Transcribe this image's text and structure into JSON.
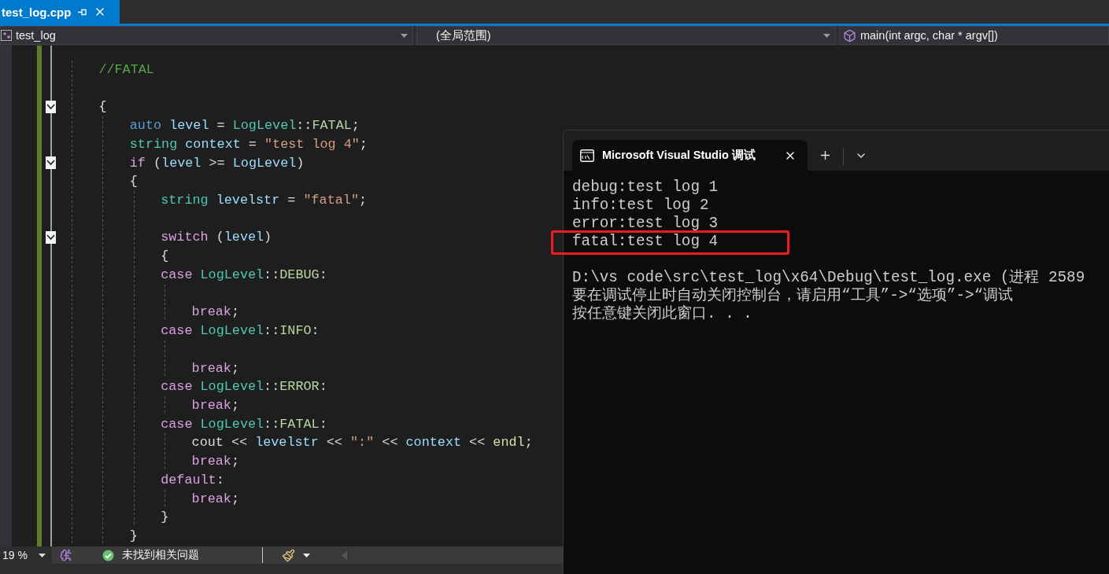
{
  "editor_tab": {
    "title": "test_log.cpp",
    "selected": true
  },
  "nav": {
    "project": "test_log",
    "scope": "(全局范围)",
    "member": "main(int argc, char * argv[])"
  },
  "code_lines": [
    {
      "kind": "code",
      "fold": false,
      "tokens": [
        {
          "kind": "comment",
          "text": "    //FATAL"
        }
      ]
    },
    {
      "kind": "blank",
      "fold": false
    },
    {
      "kind": "code",
      "fold": true,
      "tokens": [
        {
          "kind": "op",
          "text": "    {"
        }
      ]
    },
    {
      "kind": "code",
      "fold": false,
      "tokens": [
        {
          "kind": "type",
          "text": "        auto "
        },
        {
          "kind": "var",
          "text": "level"
        },
        {
          "kind": "op",
          "text": " = "
        },
        {
          "kind": "cls",
          "text": "LogLevel"
        },
        {
          "kind": "op",
          "text": "::"
        },
        {
          "kind": "member",
          "text": "FATAL"
        },
        {
          "kind": "op",
          "text": ";"
        }
      ]
    },
    {
      "kind": "code",
      "fold": false,
      "tokens": [
        {
          "kind": "cls",
          "text": "        string "
        },
        {
          "kind": "var",
          "text": "context"
        },
        {
          "kind": "op",
          "text": " = "
        },
        {
          "kind": "str",
          "text": "\"test log 4\""
        },
        {
          "kind": "op",
          "text": ";"
        }
      ]
    },
    {
      "kind": "code",
      "fold": true,
      "tokens": [
        {
          "kind": "kw",
          "text": "        if "
        },
        {
          "kind": "op",
          "text": "("
        },
        {
          "kind": "var",
          "text": "level"
        },
        {
          "kind": "op",
          "text": " >= "
        },
        {
          "kind": "var",
          "text": "LogLevel"
        },
        {
          "kind": "op",
          "text": ")"
        }
      ]
    },
    {
      "kind": "code",
      "fold": false,
      "tokens": [
        {
          "kind": "op",
          "text": "        {"
        }
      ]
    },
    {
      "kind": "code",
      "fold": false,
      "tokens": [
        {
          "kind": "cls",
          "text": "            string "
        },
        {
          "kind": "var",
          "text": "levelstr"
        },
        {
          "kind": "op",
          "text": " = "
        },
        {
          "kind": "str",
          "text": "\"fatal\""
        },
        {
          "kind": "op",
          "text": ";"
        }
      ]
    },
    {
      "kind": "blank",
      "fold": false
    },
    {
      "kind": "code",
      "fold": true,
      "tokens": [
        {
          "kind": "kw",
          "text": "            switch "
        },
        {
          "kind": "op",
          "text": "("
        },
        {
          "kind": "var",
          "text": "level"
        },
        {
          "kind": "op",
          "text": ")"
        }
      ]
    },
    {
      "kind": "code",
      "fold": false,
      "tokens": [
        {
          "kind": "op",
          "text": "            {"
        }
      ]
    },
    {
      "kind": "code",
      "fold": false,
      "tokens": [
        {
          "kind": "kw",
          "text": "            case "
        },
        {
          "kind": "cls",
          "text": "LogLevel"
        },
        {
          "kind": "op",
          "text": "::"
        },
        {
          "kind": "member",
          "text": "DEBUG"
        },
        {
          "kind": "op",
          "text": ":"
        }
      ]
    },
    {
      "kind": "blank",
      "fold": false
    },
    {
      "kind": "code",
      "fold": false,
      "tokens": [
        {
          "kind": "kw",
          "text": "                break"
        },
        {
          "kind": "op",
          "text": ";"
        }
      ]
    },
    {
      "kind": "code",
      "fold": false,
      "tokens": [
        {
          "kind": "kw",
          "text": "            case "
        },
        {
          "kind": "cls",
          "text": "LogLevel"
        },
        {
          "kind": "op",
          "text": "::"
        },
        {
          "kind": "member",
          "text": "INFO"
        },
        {
          "kind": "op",
          "text": ":"
        }
      ]
    },
    {
      "kind": "blank",
      "fold": false
    },
    {
      "kind": "code",
      "fold": false,
      "tokens": [
        {
          "kind": "kw",
          "text": "                break"
        },
        {
          "kind": "op",
          "text": ";"
        }
      ]
    },
    {
      "kind": "code",
      "fold": false,
      "tokens": [
        {
          "kind": "kw",
          "text": "            case "
        },
        {
          "kind": "cls",
          "text": "LogLevel"
        },
        {
          "kind": "op",
          "text": "::"
        },
        {
          "kind": "member",
          "text": "ERROR"
        },
        {
          "kind": "op",
          "text": ":"
        }
      ]
    },
    {
      "kind": "code",
      "fold": false,
      "tokens": [
        {
          "kind": "kw",
          "text": "                break"
        },
        {
          "kind": "op",
          "text": ";"
        }
      ]
    },
    {
      "kind": "code",
      "fold": false,
      "tokens": [
        {
          "kind": "kw",
          "text": "            case "
        },
        {
          "kind": "cls",
          "text": "LogLevel"
        },
        {
          "kind": "op",
          "text": "::"
        },
        {
          "kind": "member",
          "text": "FATAL"
        },
        {
          "kind": "op",
          "text": ":"
        }
      ]
    },
    {
      "kind": "code",
      "fold": false,
      "tokens": [
        {
          "kind": "op",
          "text": "                cout << "
        },
        {
          "kind": "var",
          "text": "levelstr"
        },
        {
          "kind": "op",
          "text": " << "
        },
        {
          "kind": "str",
          "text": "\":\""
        },
        {
          "kind": "op",
          "text": " << "
        },
        {
          "kind": "var",
          "text": "context"
        },
        {
          "kind": "op",
          "text": " << "
        },
        {
          "kind": "fn",
          "text": "endl"
        },
        {
          "kind": "op",
          "text": ";"
        }
      ]
    },
    {
      "kind": "code",
      "fold": false,
      "tokens": [
        {
          "kind": "kw",
          "text": "                break"
        },
        {
          "kind": "op",
          "text": ";"
        }
      ]
    },
    {
      "kind": "code",
      "fold": false,
      "tokens": [
        {
          "kind": "kw",
          "text": "            default"
        },
        {
          "kind": "op",
          "text": ":"
        }
      ]
    },
    {
      "kind": "code",
      "fold": false,
      "tokens": [
        {
          "kind": "kw",
          "text": "                break"
        },
        {
          "kind": "op",
          "text": ";"
        }
      ]
    },
    {
      "kind": "code",
      "fold": false,
      "tokens": [
        {
          "kind": "op",
          "text": "            }"
        }
      ]
    },
    {
      "kind": "code",
      "fold": false,
      "tokens": [
        {
          "kind": "op",
          "text": "        }"
        }
      ]
    }
  ],
  "status": {
    "zoom": "19 %",
    "issues": "未找到相关问题"
  },
  "console": {
    "tab_title": "Microsoft Visual Studio 调试",
    "output": [
      {
        "text": "debug:test log 1",
        "highlighted": false
      },
      {
        "text": "info:test log 2",
        "highlighted": false
      },
      {
        "text": "error:test log 3",
        "highlighted": false
      },
      {
        "text": "fatal:test log 4",
        "highlighted": true
      }
    ],
    "messages": [
      "D:\\vs code\\src\\test_log\\x64\\Debug\\test_log.exe (进程 2589",
      "要在调试停止时自动关闭控制台，请启用“工具”->“选项”->“调试",
      "按任意键关闭此窗口. . ."
    ]
  }
}
